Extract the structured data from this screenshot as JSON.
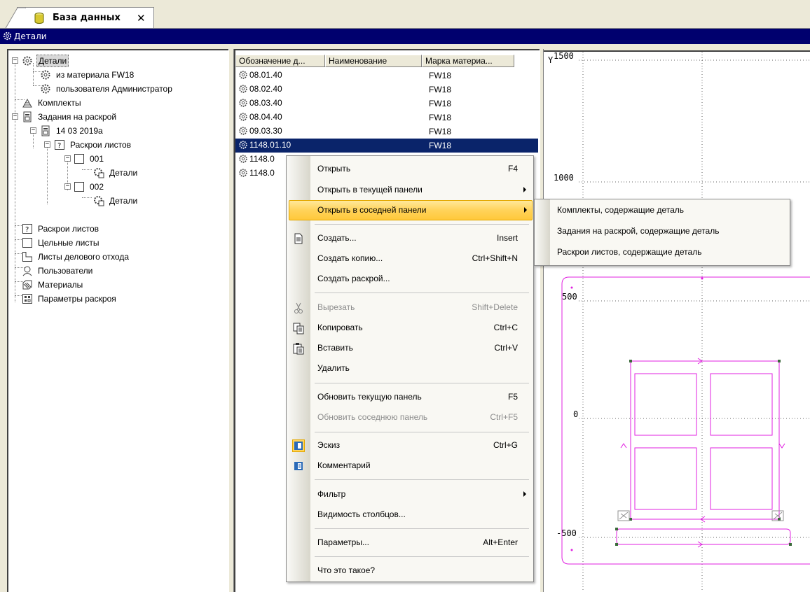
{
  "tab": {
    "title": "База данных",
    "close": "✕"
  },
  "panel": {
    "title": "Детали"
  },
  "tree": {
    "items": [
      {
        "label": "Детали",
        "icon": "part-gear-icon",
        "selected": true
      },
      {
        "label": "из материала FW18",
        "icon": "part-gear-icon"
      },
      {
        "label": "пользователя Администратор",
        "icon": "part-gear-icon"
      },
      {
        "label": "Комплекты",
        "icon": "kit-icon"
      },
      {
        "label": "Задания на раскрой",
        "icon": "task-icon"
      },
      {
        "label": "14 03 2019а",
        "icon": "task-icon"
      },
      {
        "label": "Раскрои листов",
        "icon": "question-box-icon"
      },
      {
        "label": "001",
        "icon": "sheet-icon"
      },
      {
        "label": "Детали",
        "icon": "parts-sheet-icon"
      },
      {
        "label": "002",
        "icon": "sheet-icon"
      },
      {
        "label": "Детали",
        "icon": "parts-sheet-icon"
      },
      {
        "label": "Раскрои листов",
        "icon": "question-box-icon"
      },
      {
        "label": "Цельные листы",
        "icon": "sheet-icon"
      },
      {
        "label": "Листы делового отхода",
        "icon": "waste-sheet-icon"
      },
      {
        "label": "Пользователи",
        "icon": "users-icon"
      },
      {
        "label": "Материалы",
        "icon": "materials-icon"
      },
      {
        "label": "Параметры раскроя",
        "icon": "params-icon"
      }
    ]
  },
  "list": {
    "columns": [
      "Обозначение д...",
      "Наименование",
      "Марка материа..."
    ],
    "rows": [
      {
        "designation": "08.01.40",
        "name": "",
        "material": "FW18"
      },
      {
        "designation": "08.02.40",
        "name": "",
        "material": "FW18"
      },
      {
        "designation": "08.03.40",
        "name": "",
        "material": "FW18"
      },
      {
        "designation": "08.04.40",
        "name": "",
        "material": "FW18"
      },
      {
        "designation": "09.03.30",
        "name": "",
        "material": "FW18"
      },
      {
        "designation": "1148.01.10",
        "name": "",
        "material": "FW18",
        "selected": true
      },
      {
        "designation": "1148.0",
        "name": "",
        "material": ""
      },
      {
        "designation": "1148.0",
        "name": "",
        "material": ""
      }
    ]
  },
  "canvas": {
    "y_axis_label": "Y",
    "ticks": [
      "1500",
      "1000",
      "500",
      "0",
      "-500"
    ],
    "shape_color": "#e020e0"
  },
  "context_menu": {
    "items": [
      {
        "label": "Открыть",
        "shortcut": "F4"
      },
      {
        "label": "Открыть в текущей панели",
        "submenu": true
      },
      {
        "label": "Открыть в соседней панели",
        "submenu": true,
        "highlighted": true
      },
      {
        "label": "Создать...",
        "shortcut": "Insert",
        "icon": "new-doc-icon"
      },
      {
        "label": "Создать копию...",
        "shortcut": "Ctrl+Shift+N"
      },
      {
        "label": "Создать раскрой..."
      },
      {
        "label": "Вырезать",
        "shortcut": "Shift+Delete",
        "icon": "scissors-icon",
        "disabled": true
      },
      {
        "label": "Копировать",
        "shortcut": "Ctrl+C",
        "icon": "copy-icon"
      },
      {
        "label": "Вставить",
        "shortcut": "Ctrl+V",
        "icon": "paste-icon"
      },
      {
        "label": "Удалить"
      },
      {
        "label": "Обновить текущую панель",
        "shortcut": "F5"
      },
      {
        "label": "Обновить соседнюю панель",
        "shortcut": "Ctrl+F5",
        "disabled": true
      },
      {
        "label": "Эскиз",
        "shortcut": "Ctrl+G",
        "icon": "sketch-icon"
      },
      {
        "label": "Комментарий",
        "icon": "comment-icon"
      },
      {
        "label": "Фильтр",
        "submenu": true
      },
      {
        "label": "Видимость столбцов..."
      },
      {
        "label": "Параметры...",
        "shortcut": "Alt+Enter"
      },
      {
        "label": "Что это такое?"
      }
    ]
  },
  "submenu": {
    "items": [
      "Комплекты, содержащие деталь",
      "Задания на раскрой, содержащие деталь",
      "Раскрои листов, содержащие деталь"
    ]
  }
}
